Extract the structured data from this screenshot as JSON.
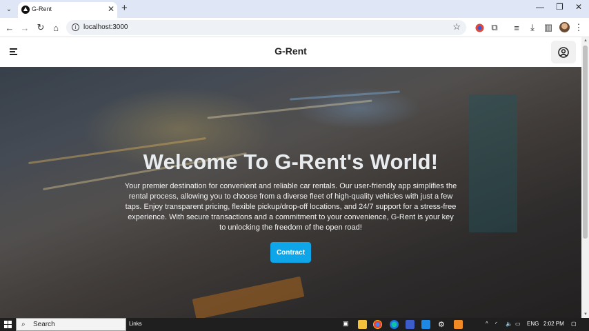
{
  "browser": {
    "tab_title": "G-Rent",
    "url": "localhost:3000",
    "tab_close": "✕",
    "new_tab": "+"
  },
  "site": {
    "brand": "G-Rent"
  },
  "hero": {
    "title": "Welcome To G-Rent's World!",
    "description": "Your premier destination for convenient and reliable car rentals. Our user-friendly app simplifies the rental process, allowing you to choose from a diverse fleet of high-quality vehicles with just a few taps. Enjoy transparent pricing, flexible pickup/drop-off locations, and 24/7 support for a stress-free experience. With secure transactions and a commitment to your convenience, G-Rent is your key to unlocking the freedom of the open road!",
    "button": "Contract"
  },
  "taskbar": {
    "search_label": "Search",
    "links_label": "Links",
    "language": "ENG",
    "time": "2:02 PM"
  },
  "colors": {
    "accent": "#0ea5e9",
    "tab_strip": "#dfe7f6",
    "taskbar": "#1f1f1f"
  }
}
